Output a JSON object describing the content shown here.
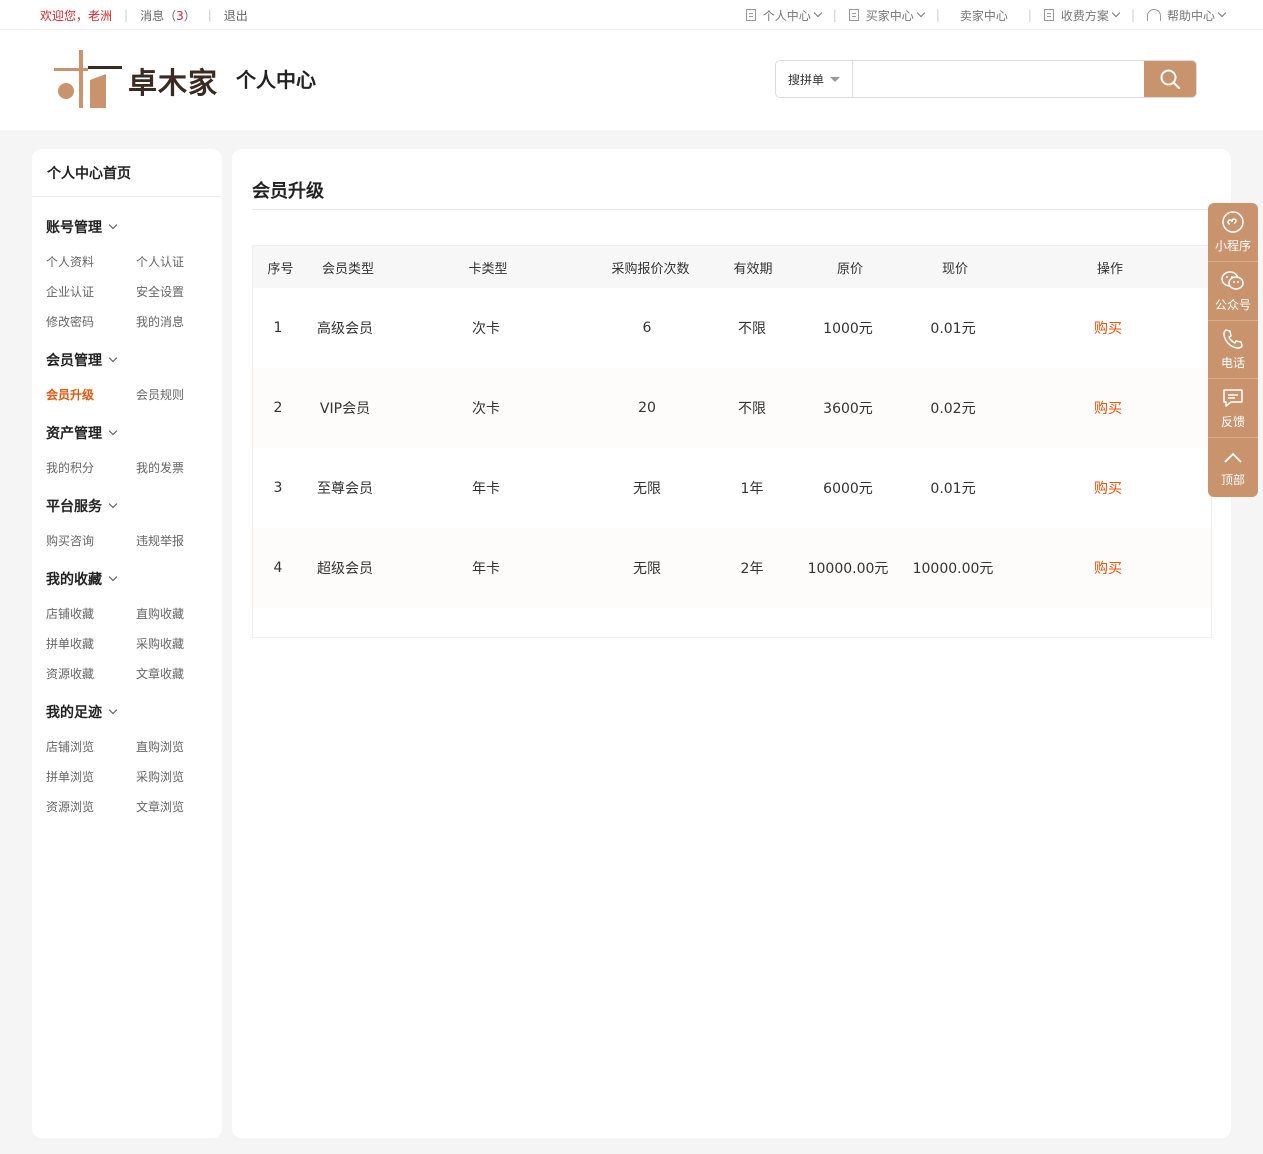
{
  "topbar": {
    "welcome": "欢迎您，老洲",
    "messages_label": "消息（",
    "messages_count": "3",
    "messages_suffix": "）",
    "logout": "退出",
    "links": [
      "个人中心",
      "买家中心",
      "卖家中心",
      "收费方案",
      "帮助中心"
    ]
  },
  "header": {
    "brand": "卓木家",
    "subtitle": "个人中心",
    "search_type": "搜拼单",
    "search_placeholder": ""
  },
  "sidebar": {
    "home": "个人中心首页",
    "sections": [
      {
        "title": "账号管理",
        "items": [
          "个人资料",
          "个人认证",
          "企业认证",
          "安全设置",
          "修改密码",
          "我的消息"
        ]
      },
      {
        "title": "会员管理",
        "items": [
          "会员升级",
          "会员规则"
        ]
      },
      {
        "title": "资产管理",
        "items": [
          "我的积分",
          "我的发票"
        ]
      },
      {
        "title": "平台服务",
        "items": [
          "购买咨询",
          "违规举报"
        ]
      },
      {
        "title": "我的收藏",
        "items": [
          "店铺收藏",
          "直购收藏",
          "拼单收藏",
          "采购收藏",
          "资源收藏",
          "文章收藏"
        ]
      },
      {
        "title": "我的足迹",
        "items": [
          "店铺浏览",
          "直购浏览",
          "拼单浏览",
          "采购浏览",
          "资源浏览",
          "文章浏览"
        ]
      }
    ]
  },
  "main": {
    "title": "会员升级",
    "columns": [
      "序号",
      "会员类型",
      "卡类型",
      "采购报价次数",
      "有效期",
      "原价",
      "现价",
      "操作"
    ],
    "rows": [
      [
        "1",
        "高级会员",
        "次卡",
        "6",
        "不限",
        "1000元",
        "0.01元",
        "购买"
      ],
      [
        "2",
        "VIP会员",
        "次卡",
        "20",
        "不限",
        "3600元",
        "0.02元",
        "购买"
      ],
      [
        "3",
        "至尊会员",
        "年卡",
        "无限",
        "1年",
        "6000元",
        "0.01元",
        "购买"
      ],
      [
        "4",
        "超级会员",
        "年卡",
        "无限",
        "2年",
        "10000.00元",
        "10000.00元",
        "购买"
      ]
    ]
  },
  "float_tools": [
    "小程序",
    "公众号",
    "电话",
    "反馈",
    "顶部"
  ],
  "colors": {
    "accent": "#c9936d",
    "highlight": "#e5560e",
    "alert": "#d7262b"
  }
}
